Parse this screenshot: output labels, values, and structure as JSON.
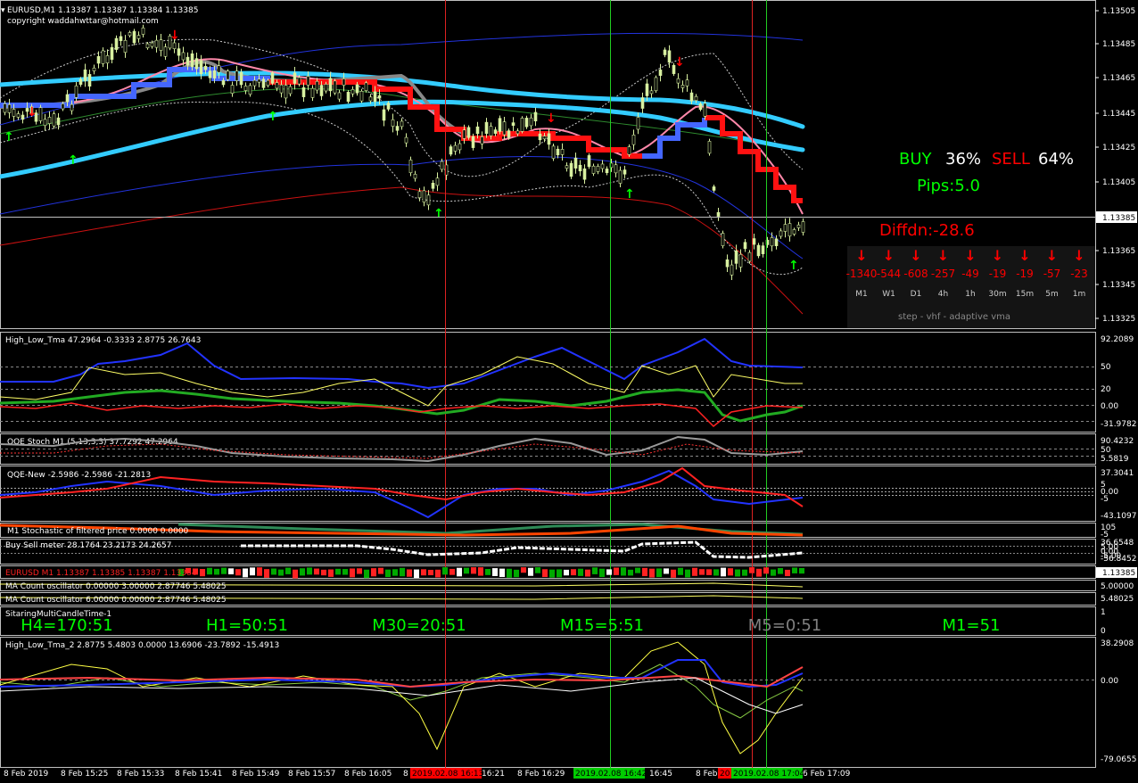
{
  "main": {
    "header_line1": "EURUSD,M1  1.13387 1.13387 1.13384 1.13385",
    "header_line2": "copyright waddahwttar@hotmail.com",
    "price_ticks": [
      "1.13505",
      "1.13485",
      "1.13465",
      "1.13445",
      "1.13425",
      "1.13405",
      "1.13365",
      "1.13345",
      "1.13325"
    ],
    "current_price": "1.13385",
    "buy_label": "BUY",
    "buy_pct": "36%",
    "sell_label": "SELL",
    "sell_pct": "64%",
    "pips": "Pips:5.0",
    "diff": "Diffdn:-28.6",
    "tf_values": [
      "-1340",
      "-544",
      "-608",
      "-257",
      "-49",
      "-19",
      "-19",
      "-57",
      "-23"
    ],
    "tf_names": [
      "M1",
      "W1",
      "D1",
      "4h",
      "1h",
      "30m",
      "15m",
      "5m",
      "1m"
    ],
    "panel_footer": "step - vhf - adaptive vma",
    "colors": {
      "buy": "#00ff00",
      "sell": "#ff0000",
      "band": "#33ccff",
      "bg": "#000000"
    }
  },
  "subwindows": {
    "hl_tma": {
      "title": "High_Low_Tma 47.2964 -0.3333 2.8775 26.7643",
      "ticks": [
        "92.2089",
        "50",
        "20",
        "0.00",
        "-31.9782"
      ]
    },
    "qqe_stoch": {
      "title": "QQE Stoch  M1 (5,13,3,3) 37.7292 47.2964",
      "ticks": [
        "90.4232",
        "50",
        "5.5819"
      ]
    },
    "qqe_new": {
      "title": "QQE-New -2.5986 -2.5986 -21.2813",
      "ticks": [
        "37.3041",
        "5",
        "0.00",
        "-5",
        "-43.1097"
      ]
    },
    "stoch_filtered": {
      "title": "M1 Stochastic of filtered price 0.0000 0.0000",
      "ticks": [
        "105",
        "-5"
      ]
    },
    "buy_sell_meter": {
      "title": "Buy Sell meter 28.1764 23.2173 24.2657",
      "ticks": [
        "36.6548",
        "5.00",
        "0.00",
        "-5.00",
        "-56.8452"
      ]
    },
    "eurusd_candles": {
      "title": "EURUSD M1 1.13387 1.13385 1.13387 1.13384",
      "ticks": [
        "1.13385"
      ]
    },
    "ma_count_1": {
      "title": "MA Count oscillator 0.00000 3.00000 2.87746 5.48025",
      "ticks": [
        "5.00000"
      ]
    },
    "ma_count_2": {
      "title": "MA Count oscillator 6.00000 0.00000 2.87746 5.48025",
      "ticks": [
        "5.48025"
      ]
    },
    "candle_time": {
      "title": "SitaringMultiCandleTime-1",
      "tick_top": "1",
      "tick_bottom": "0",
      "items": [
        {
          "label": "H4=170:51",
          "color": "#00ff00"
        },
        {
          "label": "H1=50:51",
          "color": "#00ff00"
        },
        {
          "label": "M30=20:51",
          "color": "#00ff00"
        },
        {
          "label": "M15=5:51",
          "color": "#00ff00"
        },
        {
          "label": "M5=0:51",
          "color": "#808080"
        },
        {
          "label": "M1=51",
          "color": "#00ff00"
        }
      ]
    },
    "hl_tma_2": {
      "title": "High_Low_Tma_2 2.8775 5.4803 0.0000 13.6906 -23.7892 -15.4913",
      "ticks": [
        "38.2908",
        "0.00",
        "-79.0655"
      ]
    }
  },
  "time_axis": {
    "labels": [
      "8 Feb 2019",
      "8 Feb 15:25",
      "8 Feb 15:33",
      "8 Feb 15:41",
      "8 Feb 15:49",
      "8 Feb 15:57",
      "8 Feb 16:05",
      "8",
      "16:21",
      "8 Feb 16:29",
      "16:45",
      "8 Feb 1",
      "6 Feb 17:09"
    ],
    "markers": [
      {
        "label": "2019.02.08 16:13",
        "bg": "#ff0000"
      },
      {
        "label": "2019.02.08 16:42",
        "bg": "#00cc00"
      },
      {
        "label": "20",
        "bg": "#ff0000"
      },
      {
        "label": "2019.02.08 17:04",
        "bg": "#00cc00"
      }
    ]
  }
}
